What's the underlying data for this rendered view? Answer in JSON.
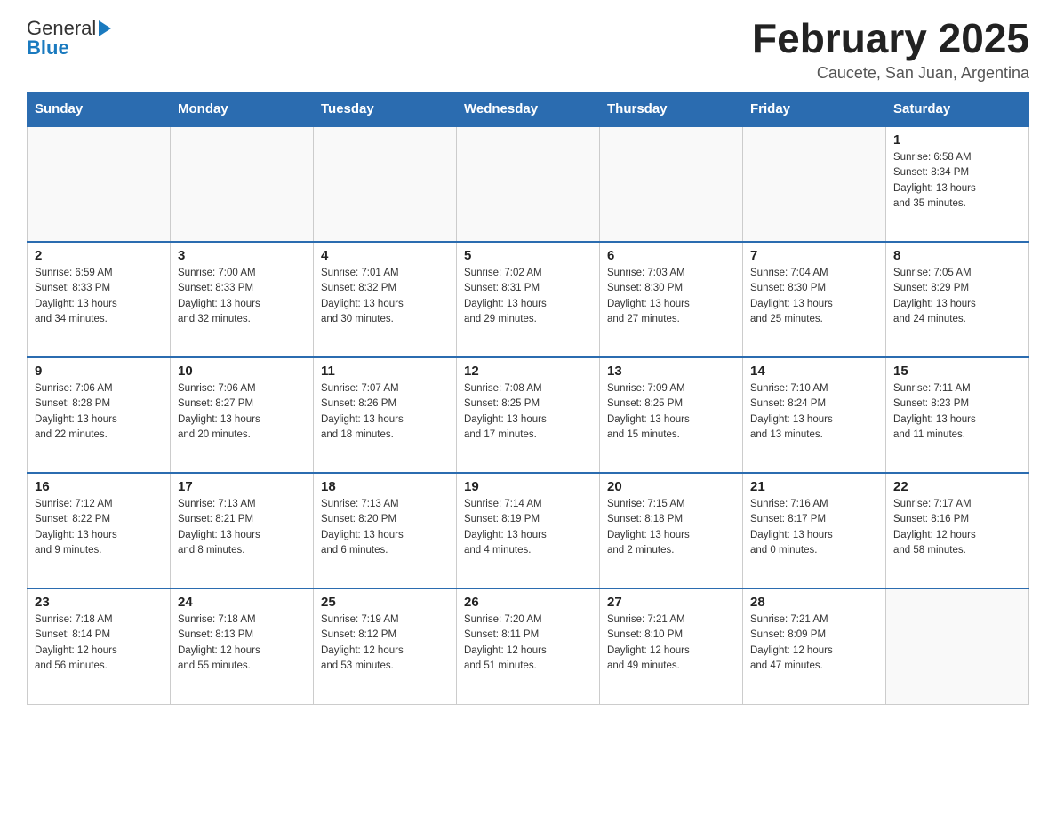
{
  "header": {
    "logo_general": "General",
    "logo_blue": "Blue",
    "month_title": "February 2025",
    "location": "Caucete, San Juan, Argentina"
  },
  "weekdays": [
    "Sunday",
    "Monday",
    "Tuesday",
    "Wednesday",
    "Thursday",
    "Friday",
    "Saturday"
  ],
  "weeks": [
    [
      {
        "day": "",
        "info": ""
      },
      {
        "day": "",
        "info": ""
      },
      {
        "day": "",
        "info": ""
      },
      {
        "day": "",
        "info": ""
      },
      {
        "day": "",
        "info": ""
      },
      {
        "day": "",
        "info": ""
      },
      {
        "day": "1",
        "info": "Sunrise: 6:58 AM\nSunset: 8:34 PM\nDaylight: 13 hours\nand 35 minutes."
      }
    ],
    [
      {
        "day": "2",
        "info": "Sunrise: 6:59 AM\nSunset: 8:33 PM\nDaylight: 13 hours\nand 34 minutes."
      },
      {
        "day": "3",
        "info": "Sunrise: 7:00 AM\nSunset: 8:33 PM\nDaylight: 13 hours\nand 32 minutes."
      },
      {
        "day": "4",
        "info": "Sunrise: 7:01 AM\nSunset: 8:32 PM\nDaylight: 13 hours\nand 30 minutes."
      },
      {
        "day": "5",
        "info": "Sunrise: 7:02 AM\nSunset: 8:31 PM\nDaylight: 13 hours\nand 29 minutes."
      },
      {
        "day": "6",
        "info": "Sunrise: 7:03 AM\nSunset: 8:30 PM\nDaylight: 13 hours\nand 27 minutes."
      },
      {
        "day": "7",
        "info": "Sunrise: 7:04 AM\nSunset: 8:30 PM\nDaylight: 13 hours\nand 25 minutes."
      },
      {
        "day": "8",
        "info": "Sunrise: 7:05 AM\nSunset: 8:29 PM\nDaylight: 13 hours\nand 24 minutes."
      }
    ],
    [
      {
        "day": "9",
        "info": "Sunrise: 7:06 AM\nSunset: 8:28 PM\nDaylight: 13 hours\nand 22 minutes."
      },
      {
        "day": "10",
        "info": "Sunrise: 7:06 AM\nSunset: 8:27 PM\nDaylight: 13 hours\nand 20 minutes."
      },
      {
        "day": "11",
        "info": "Sunrise: 7:07 AM\nSunset: 8:26 PM\nDaylight: 13 hours\nand 18 minutes."
      },
      {
        "day": "12",
        "info": "Sunrise: 7:08 AM\nSunset: 8:25 PM\nDaylight: 13 hours\nand 17 minutes."
      },
      {
        "day": "13",
        "info": "Sunrise: 7:09 AM\nSunset: 8:25 PM\nDaylight: 13 hours\nand 15 minutes."
      },
      {
        "day": "14",
        "info": "Sunrise: 7:10 AM\nSunset: 8:24 PM\nDaylight: 13 hours\nand 13 minutes."
      },
      {
        "day": "15",
        "info": "Sunrise: 7:11 AM\nSunset: 8:23 PM\nDaylight: 13 hours\nand 11 minutes."
      }
    ],
    [
      {
        "day": "16",
        "info": "Sunrise: 7:12 AM\nSunset: 8:22 PM\nDaylight: 13 hours\nand 9 minutes."
      },
      {
        "day": "17",
        "info": "Sunrise: 7:13 AM\nSunset: 8:21 PM\nDaylight: 13 hours\nand 8 minutes."
      },
      {
        "day": "18",
        "info": "Sunrise: 7:13 AM\nSunset: 8:20 PM\nDaylight: 13 hours\nand 6 minutes."
      },
      {
        "day": "19",
        "info": "Sunrise: 7:14 AM\nSunset: 8:19 PM\nDaylight: 13 hours\nand 4 minutes."
      },
      {
        "day": "20",
        "info": "Sunrise: 7:15 AM\nSunset: 8:18 PM\nDaylight: 13 hours\nand 2 minutes."
      },
      {
        "day": "21",
        "info": "Sunrise: 7:16 AM\nSunset: 8:17 PM\nDaylight: 13 hours\nand 0 minutes."
      },
      {
        "day": "22",
        "info": "Sunrise: 7:17 AM\nSunset: 8:16 PM\nDaylight: 12 hours\nand 58 minutes."
      }
    ],
    [
      {
        "day": "23",
        "info": "Sunrise: 7:18 AM\nSunset: 8:14 PM\nDaylight: 12 hours\nand 56 minutes."
      },
      {
        "day": "24",
        "info": "Sunrise: 7:18 AM\nSunset: 8:13 PM\nDaylight: 12 hours\nand 55 minutes."
      },
      {
        "day": "25",
        "info": "Sunrise: 7:19 AM\nSunset: 8:12 PM\nDaylight: 12 hours\nand 53 minutes."
      },
      {
        "day": "26",
        "info": "Sunrise: 7:20 AM\nSunset: 8:11 PM\nDaylight: 12 hours\nand 51 minutes."
      },
      {
        "day": "27",
        "info": "Sunrise: 7:21 AM\nSunset: 8:10 PM\nDaylight: 12 hours\nand 49 minutes."
      },
      {
        "day": "28",
        "info": "Sunrise: 7:21 AM\nSunset: 8:09 PM\nDaylight: 12 hours\nand 47 minutes."
      },
      {
        "day": "",
        "info": ""
      }
    ]
  ]
}
